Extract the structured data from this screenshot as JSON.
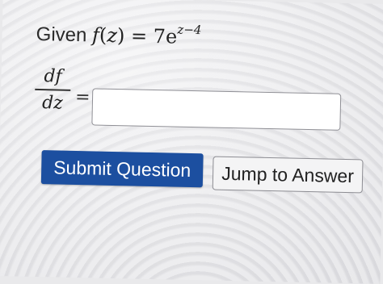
{
  "question": {
    "given_label": "Given",
    "func_name": "f",
    "func_arg": "z",
    "equals": "=",
    "coefficient": "7e",
    "exponent": "z−4"
  },
  "derivative": {
    "numerator": "df",
    "denominator": "dz",
    "equals": "="
  },
  "answer": {
    "value": "",
    "placeholder": ""
  },
  "buttons": {
    "submit_label": "Submit Question",
    "jump_label": "Jump to Answer"
  },
  "colors": {
    "submit_bg": "#1c4fa0",
    "submit_text": "#ffffff",
    "jump_bg": "#f4f4f5",
    "jump_border": "#8c8c92"
  }
}
